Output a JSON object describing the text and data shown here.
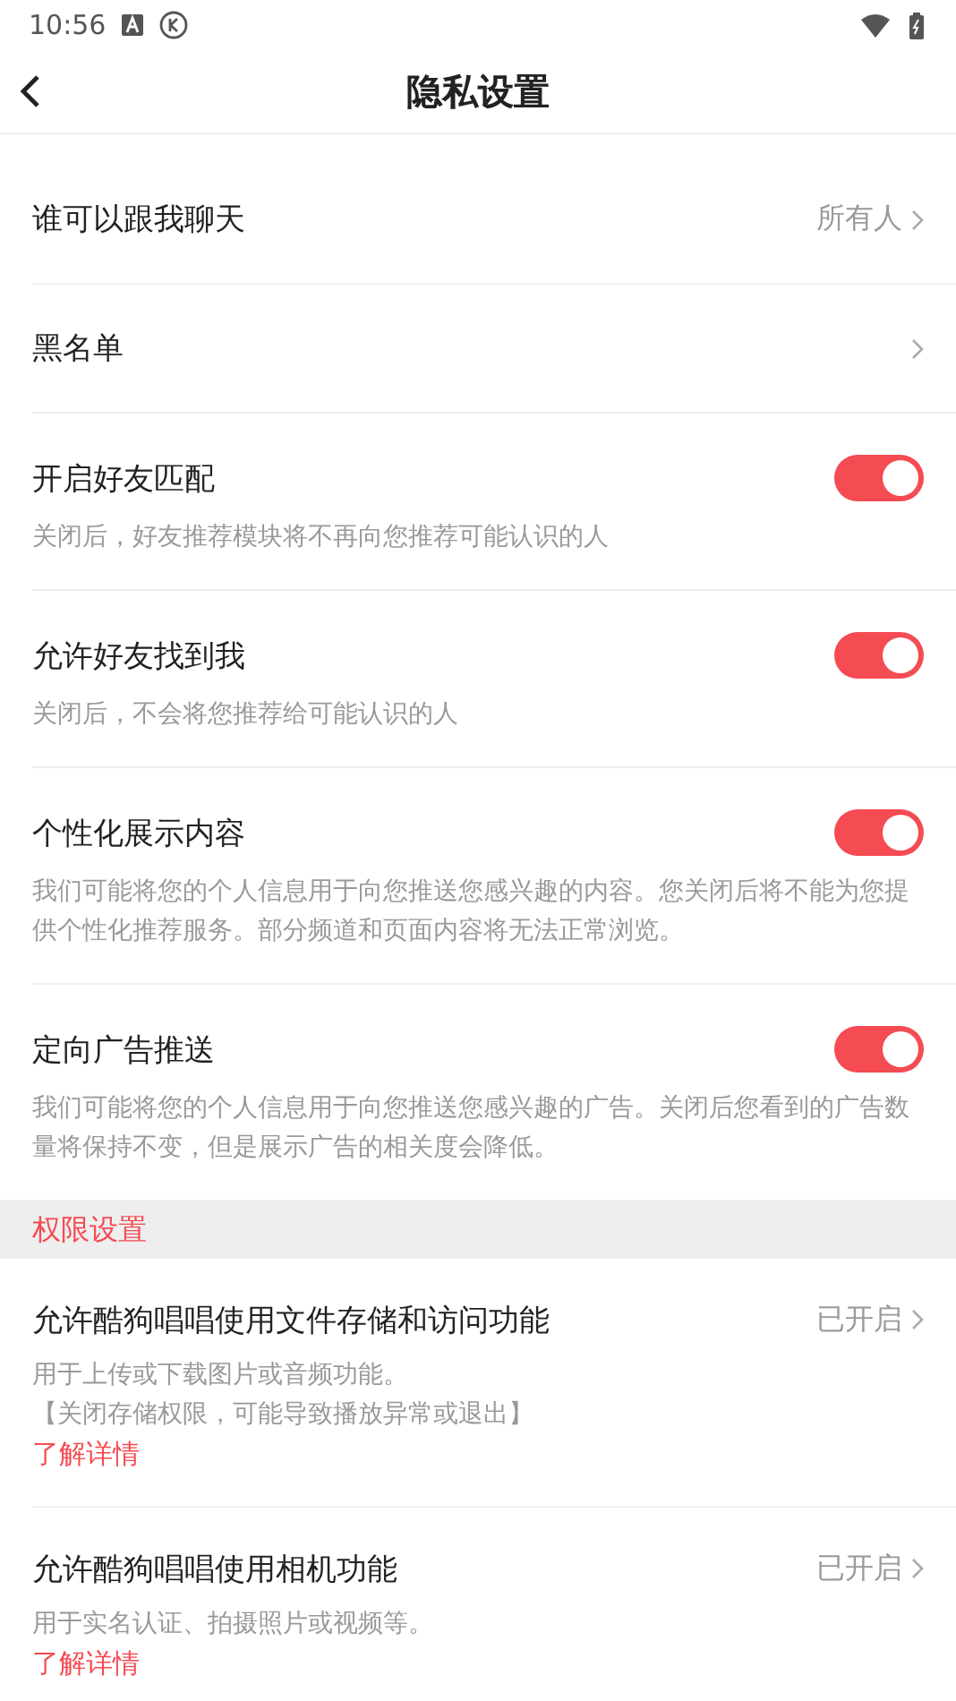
{
  "status_bar": {
    "time": "10:56"
  },
  "header": {
    "title": "隐私设置"
  },
  "items": [
    {
      "kind": "link",
      "title": "谁可以跟我聊天",
      "value": "所有人"
    },
    {
      "kind": "link",
      "title": "黑名单"
    },
    {
      "kind": "toggle",
      "title": "开启好友匹配",
      "on": true,
      "description": "关闭后，好友推荐模块将不再向您推荐可能认识的人"
    },
    {
      "kind": "toggle",
      "title": "允许好友找到我",
      "on": true,
      "description": "关闭后，不会将您推荐给可能认识的人"
    },
    {
      "kind": "toggle",
      "title": "个性化展示内容",
      "on": true,
      "description": "我们可能将您的个人信息用于向您推送您感兴趣的内容。您关闭后将不能为您提供个性化推荐服务。部分频道和页面内容将无法正常浏览。"
    },
    {
      "kind": "toggle",
      "title": "定向广告推送",
      "on": true,
      "description": "我们可能将您的个人信息用于向您推送您感兴趣的广告。关闭后您看到的广告数量将保持不变，但是展示广告的相关度会降低。"
    },
    {
      "kind": "section",
      "title": "权限设置"
    },
    {
      "kind": "permission",
      "title": "允许酷狗唱唱使用文件存储和访问功能",
      "value": "已开启",
      "description": "用于上传或下载图片或音频功能。",
      "note": "【关闭存储权限，可能导致播放异常或退出】",
      "link": "了解详情"
    },
    {
      "kind": "permission",
      "title": "允许酷狗唱唱使用相机功能",
      "value": "已开启",
      "description": "用于实名认证、拍摄照片或视频等。",
      "link": "了解详情"
    }
  ]
}
